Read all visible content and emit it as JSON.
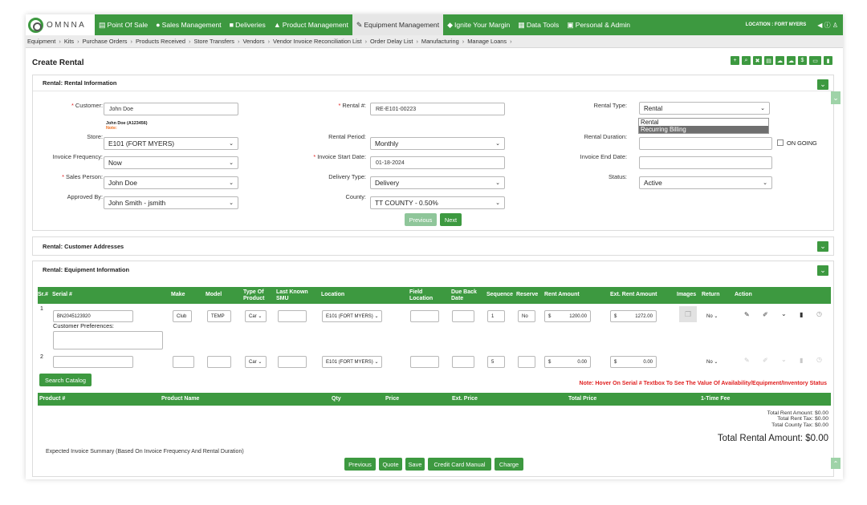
{
  "nav": {
    "logo": "OMNNA",
    "items": [
      {
        "icon": "▤",
        "label": "Point Of Sale",
        "icon_name": "pos-icon"
      },
      {
        "icon": "●",
        "label": "Sales Management",
        "icon_name": "user-icon"
      },
      {
        "icon": "■",
        "label": "Deliveries",
        "icon_name": "truck-icon"
      },
      {
        "icon": "▲",
        "label": "Product Management",
        "icon_name": "sitemap-icon"
      },
      {
        "icon": "✎",
        "label": "Equipment Management",
        "icon_name": "tools-icon"
      },
      {
        "icon": "◆",
        "label": "Ignite Your Margin",
        "icon_name": "tag-icon"
      },
      {
        "icon": "▦",
        "label": "Data Tools",
        "icon_name": "database-icon"
      },
      {
        "icon": "▣",
        "label": "Personal & Admin",
        "icon_name": "id-card-icon"
      }
    ],
    "location": "LOCATION : FORT MYERS",
    "right_icons": "◀ ⓘ ♙"
  },
  "breadcrumbs": [
    "Equipment",
    "Kits",
    "Purchase Orders",
    "Products Received",
    "Store Transfers",
    "Vendors",
    "Vendor Invoice Reconciliation List",
    "Order Delay List",
    "Manufacturing",
    "Manage Loans"
  ],
  "page_title": "Create Rental",
  "toolbar_icons": [
    "+",
    "⌕",
    "✖",
    "▤",
    "☁",
    "☁",
    "$",
    "▭",
    "▮"
  ],
  "rental_info": {
    "header": "Rental: Rental Information",
    "customer_label": "Customer:",
    "customer_value": "John Doe",
    "customer_sub": "John Doe (A123456)",
    "customer_note": "Note:",
    "rental_no_label": "Rental #:",
    "rental_no_value": "RE-E101-00223",
    "rental_type_label": "Rental Type:",
    "rental_type_value": "Rental",
    "rental_type_options": [
      "Rental",
      "Recurring Billing"
    ],
    "store_label": "Store:",
    "store_value": "E101 (FORT MYERS)",
    "period_label": "Rental Period:",
    "period_value": "Monthly",
    "duration_label": "Rental Duration:",
    "duration_value": "",
    "ongoing_label": "ON GOING",
    "inv_freq_label": "Invoice Frequency:",
    "inv_freq_value": "Now",
    "inv_start_label": "Invoice Start Date:",
    "inv_start_value": "01-18-2024",
    "inv_end_label": "Invoice End Date:",
    "inv_end_value": "",
    "sales_label": "Sales Person:",
    "sales_value": "John Doe",
    "delivery_label": "Delivery Type:",
    "delivery_value": "Delivery",
    "status_label": "Status:",
    "status_value": "Active",
    "approved_label": "Approved By:",
    "approved_value": "John Smith - jsmith",
    "county_label": "County:",
    "county_value": "TT COUNTY - 0.50%",
    "prev_btn": "Previous",
    "next_btn": "Next"
  },
  "addresses_header": "Rental: Customer Addresses",
  "equipment": {
    "header": "Rental: Equipment Information",
    "columns": [
      "Sr.#",
      "Serial #",
      "Make",
      "Model",
      "Type Of Product",
      "Last Known SMU",
      "Location",
      "Field Location",
      "Due Back Date",
      "Sequence",
      "Reserve",
      "Rent Amount",
      "Ext. Rent Amount",
      "Images",
      "Return",
      "Action"
    ],
    "rows": [
      {
        "sr": "1",
        "serial": "BN2045123920",
        "make": "Club",
        "model": "TEMP",
        "type": "Car",
        "location": "E101 (FORT MYERS)",
        "sequence": "1",
        "reserve": "No",
        "rent": "1200.00",
        "ext_rent": "1272.00",
        "return": "No",
        "prefs_label": "Customer Preferences:"
      },
      {
        "sr": "2",
        "serial": "",
        "make": "",
        "model": "",
        "type": "Car",
        "location": "E101 (FORT MYERS)",
        "sequence": "5",
        "reserve": "",
        "rent": "0.00",
        "ext_rent": "0.00",
        "return": "No"
      }
    ],
    "currency": "$",
    "search_btn": "Search Catalog",
    "note": "Note: Hover On Serial # Textbox To See The Value Of Availability/Equipment/Inventory Status",
    "product_columns": [
      "Product #",
      "Product Name",
      "Qty",
      "Price",
      "Ext. Price",
      "Total Price",
      "1-Time Fee"
    ],
    "totals": [
      "Total Rent Amount: $0.00",
      "Total Rent Tax: $0.00",
      "Total County Tax: $0.00"
    ],
    "grand_total": "Total Rental Amount: $0.00",
    "summary_label": "Expected Invoice Summary (Based On Invoice Frequency And Rental Duration)",
    "buttons": [
      "Previous",
      "Quote",
      "Save",
      "Credit Card Manual",
      "Charge"
    ]
  }
}
